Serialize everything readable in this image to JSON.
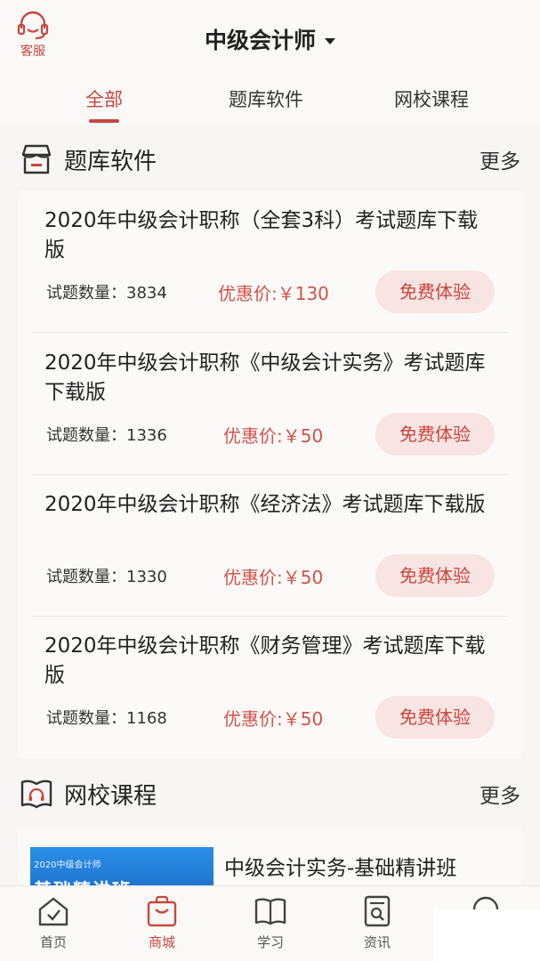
{
  "header": {
    "service_label": "客服",
    "title": "中级会计师"
  },
  "tabs": [
    {
      "label": "全部"
    },
    {
      "label": "题库软件"
    },
    {
      "label": "网校课程"
    }
  ],
  "question_bank": {
    "title": "题库软件",
    "more": "更多",
    "items": [
      {
        "title": "2020年中级会计职称（全套3科）考试题库下载版",
        "count": "试题数量：3834",
        "price": "优惠价:￥130",
        "button": "免费体验"
      },
      {
        "title": "2020年中级会计职称《中级会计实务》考试题库下载版",
        "count": "试题数量：1336",
        "price": "优惠价:￥50",
        "button": "免费体验"
      },
      {
        "title": "2020年中级会计职称《经济法》考试题库下载版",
        "count": "试题数量：1330",
        "price": "优惠价:￥50",
        "button": "免费体验"
      },
      {
        "title": "2020年中级会计职称《财务管理》考试题库下载版",
        "count": "试题数量：1168",
        "price": "优惠价:￥50",
        "button": "免费体验"
      }
    ]
  },
  "online_courses": {
    "title": "网校课程",
    "more": "更多",
    "items": [
      {
        "title": "中级会计实务-基础精讲班",
        "thumb_tag": "2020中级会计师",
        "thumb_title": "基础精讲班"
      }
    ]
  },
  "bottom_nav": [
    {
      "label": "首页",
      "icon": "home-icon"
    },
    {
      "label": "商城",
      "icon": "shopping-bag-icon"
    },
    {
      "label": "学习",
      "icon": "book-icon"
    },
    {
      "label": "资讯",
      "icon": "news-icon"
    }
  ],
  "colors": {
    "accent": "#c9463d",
    "price": "#d4504a",
    "button_bg": "#f8e4e2",
    "background": "#f7f6f4"
  }
}
